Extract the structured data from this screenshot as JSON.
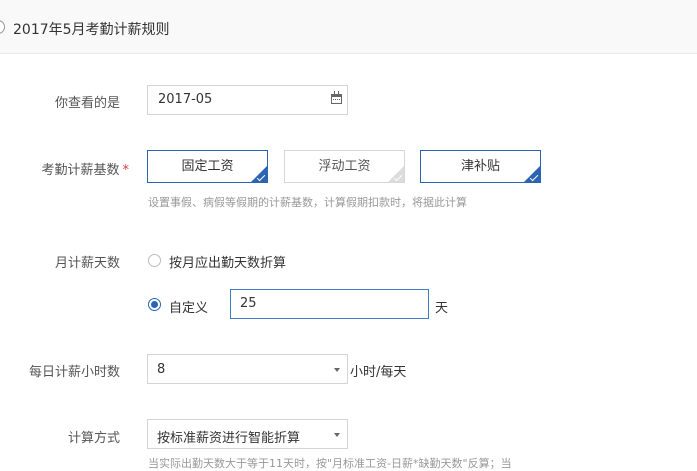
{
  "header": {
    "title": "2017年5月考勤计薪规则"
  },
  "view_period": {
    "label": "你查看的是",
    "value": "2017-05"
  },
  "salary_base": {
    "label": "考勤计薪基数",
    "required_mark": "*",
    "options": [
      {
        "label": "固定工资",
        "selected": true
      },
      {
        "label": "浮动工资",
        "selected": false
      },
      {
        "label": "津补贴",
        "selected": true
      }
    ],
    "hint": "设置事假、病假等假期的计薪基数，计算假期扣款时，将据此计算"
  },
  "monthly_days": {
    "label": "月计薪天数",
    "option_by_month": "按月应出勤天数折算",
    "option_custom": "自定义",
    "selected": "custom",
    "custom_value": "25",
    "unit": "天"
  },
  "daily_hours": {
    "label": "每日计薪小时数",
    "value": "8",
    "unit": "小时/每天"
  },
  "calc_method": {
    "label": "计算方式",
    "value": "按标准薪资进行智能折算",
    "hint": "当实际出勤天数大于等于11天时，按\"月标准工资-日薪*缺勤天数\"反算；当"
  },
  "colors": {
    "accent": "#2a64b2",
    "required": "#e03c3c",
    "hint": "#999999"
  }
}
